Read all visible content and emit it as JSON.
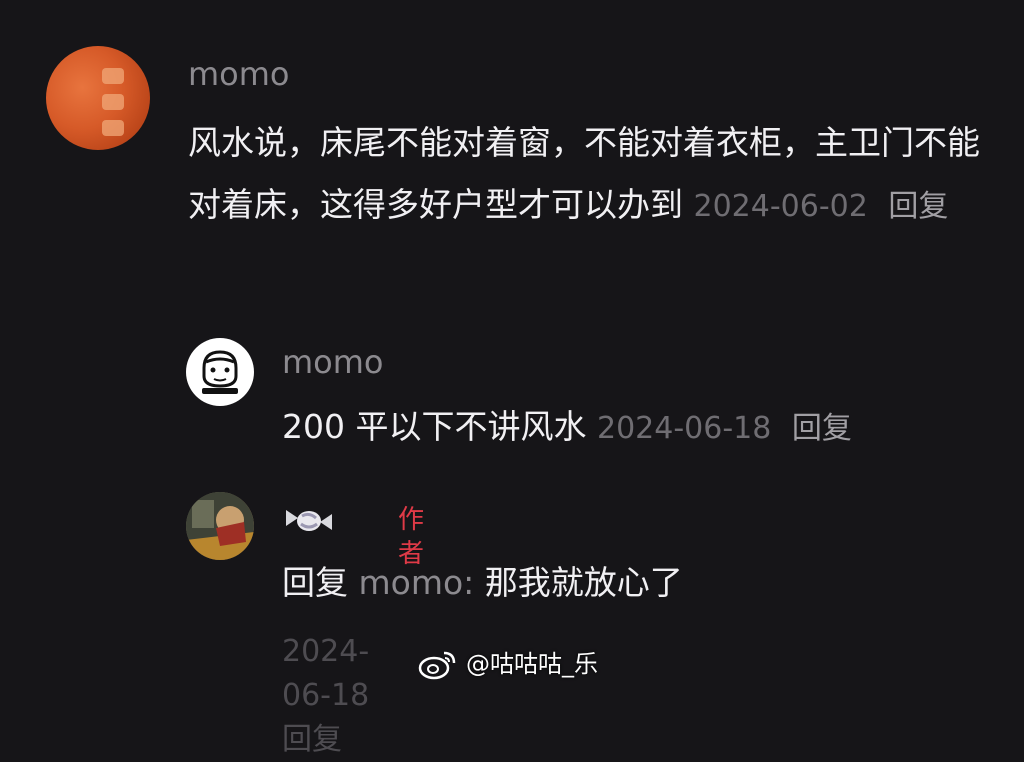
{
  "comments": [
    {
      "username": "momo",
      "text": "风水说，床尾不能对着窗，不能对着衣柜，主卫门不能对着床，这得多好户型才可以办到",
      "date": "2024-06-02",
      "reply_label": "回复",
      "avatar_icon": "orange-avatar-icon"
    },
    {
      "username": "momo",
      "text": "200 平以下不讲风水",
      "date": "2024-06-18",
      "reply_label": "回复",
      "avatar_icon": "cartoon-face-avatar-icon"
    },
    {
      "username_icon": "candy-icon",
      "badge": "作者",
      "reply_prefix": "回复",
      "mention": "momo:",
      "text": "那我就放心了",
      "date": "2024-06-18",
      "reply_label": "回复",
      "avatar_icon": "photo-avatar-icon"
    }
  ],
  "watermark": {
    "icon": "weibo-logo-icon",
    "handle": "@咕咕咕_乐"
  },
  "colors": {
    "background": "#161518",
    "author_badge": "#e03a47"
  }
}
